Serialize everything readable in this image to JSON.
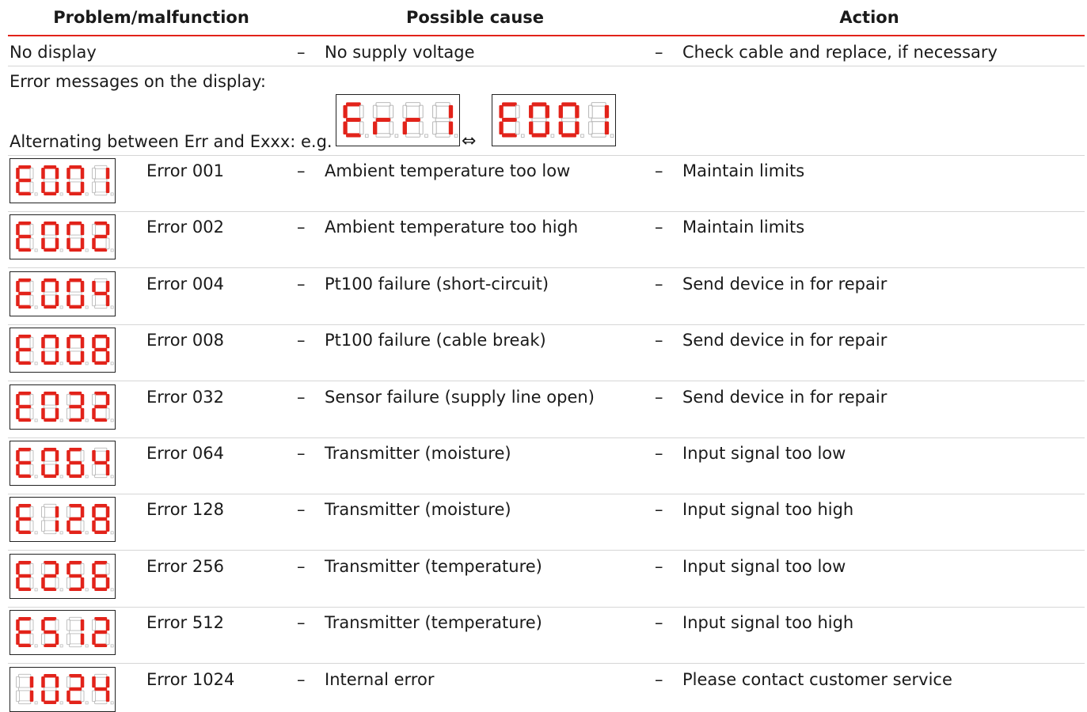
{
  "header": {
    "problem": "Problem/malfunction",
    "cause": "Possible cause",
    "action": "Action"
  },
  "no_display": {
    "problem": "No display",
    "cause": "No supply voltage",
    "action": "Check cable and replace, if necessary"
  },
  "error_messages_label": "Error messages on the display:",
  "alternating_label": "Alternating between Err and Exxx: e.g.",
  "dash": "–",
  "example_display": [
    "Err1",
    "E001"
  ],
  "colors": {
    "accent": "#e2231a",
    "segment_on": "#e2231a",
    "segment_off": "#b9b9b9"
  },
  "rows": [
    {
      "display": "E001",
      "error": "Error 001",
      "cause": "Ambient temperature too low",
      "action": "Maintain limits"
    },
    {
      "display": "E002",
      "error": "Error 002",
      "cause": "Ambient temperature too high",
      "action": "Maintain limits"
    },
    {
      "display": "E004",
      "error": "Error 004",
      "cause": "Pt100 failure (short-circuit)",
      "action": "Send device in for repair"
    },
    {
      "display": "E008",
      "error": "Error 008",
      "cause": "Pt100 failure (cable break)",
      "action": "Send device in for repair"
    },
    {
      "display": "E032",
      "error": "Error 032",
      "cause": "Sensor failure (supply line open)",
      "action": "Send device in for repair"
    },
    {
      "display": "E064",
      "error": "Error 064",
      "cause": "Transmitter (moisture)",
      "action": "Input signal too low"
    },
    {
      "display": "E128",
      "error": "Error 128",
      "cause": "Transmitter (moisture)",
      "action": "Input signal too high"
    },
    {
      "display": "E256",
      "error": "Error 256",
      "cause": "Transmitter (temperature)",
      "action": "Input signal too low"
    },
    {
      "display": "E512",
      "error": "Error 512",
      "cause": "Transmitter (temperature)",
      "action": "Input signal too high"
    },
    {
      "display": "1024",
      "error": "Error 1024",
      "cause": "Internal error",
      "action": "Please contact customer service"
    }
  ]
}
